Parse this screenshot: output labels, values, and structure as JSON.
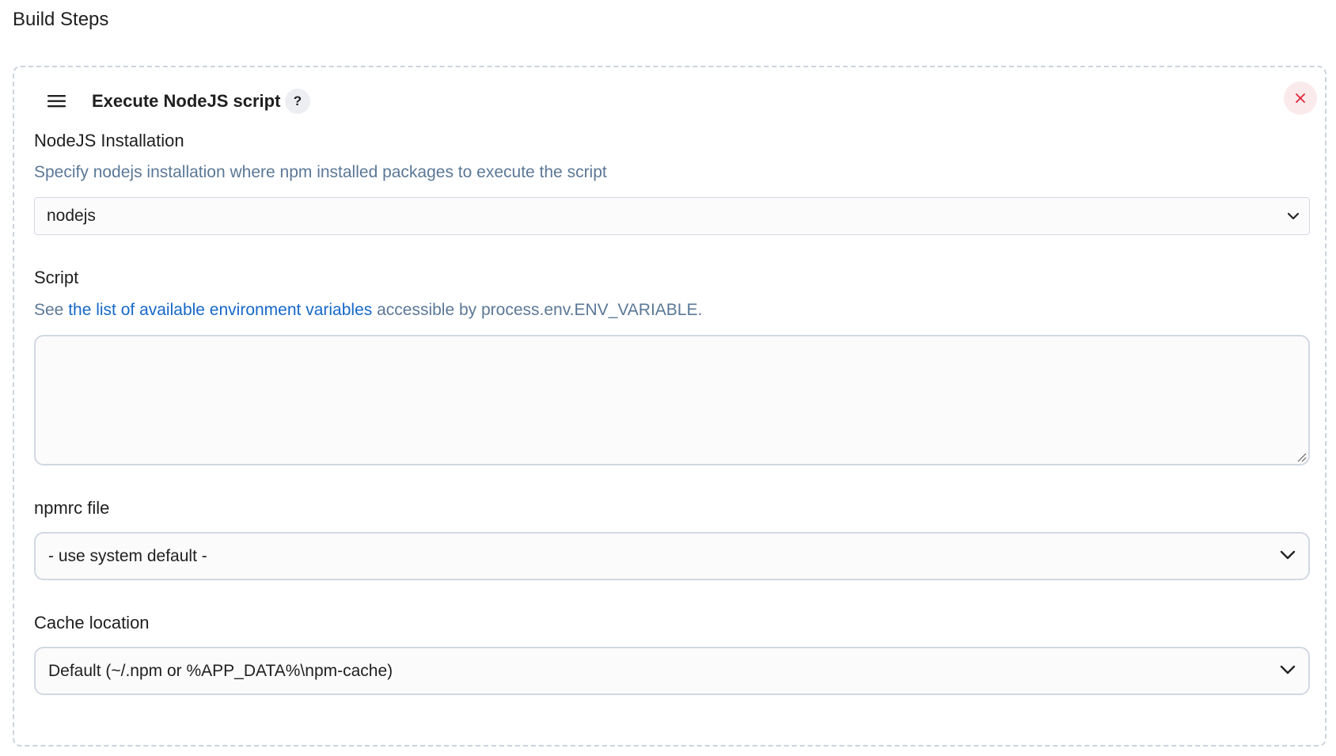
{
  "section": {
    "title": "Build Steps"
  },
  "step": {
    "title": "Execute NodeJS script",
    "help_label": "?",
    "drag_icon": "hamburger-menu-icon",
    "close_icon": "close-x-icon"
  },
  "fields": {
    "nodejs": {
      "label": "NodeJS Installation",
      "description": "Specify nodejs installation where npm installed packages to execute the script",
      "selected": "nodejs"
    },
    "script": {
      "label": "Script",
      "desc_prefix": "See ",
      "desc_link": "the list of available environment variables",
      "desc_suffix": " accessible by process.env.ENV_VARIABLE.",
      "value": ""
    },
    "npmrc": {
      "label": "npmrc file",
      "selected": "- use system default -"
    },
    "cache": {
      "label": "Cache location",
      "selected": "Default (~/.npm or %APP_DATA%\\npm-cache)"
    }
  },
  "colors": {
    "link": "#1668c9",
    "description": "#5b7897",
    "close_icon": "#e0263b",
    "close_bg": "#fbeaec",
    "border": "#d2d8e2"
  }
}
